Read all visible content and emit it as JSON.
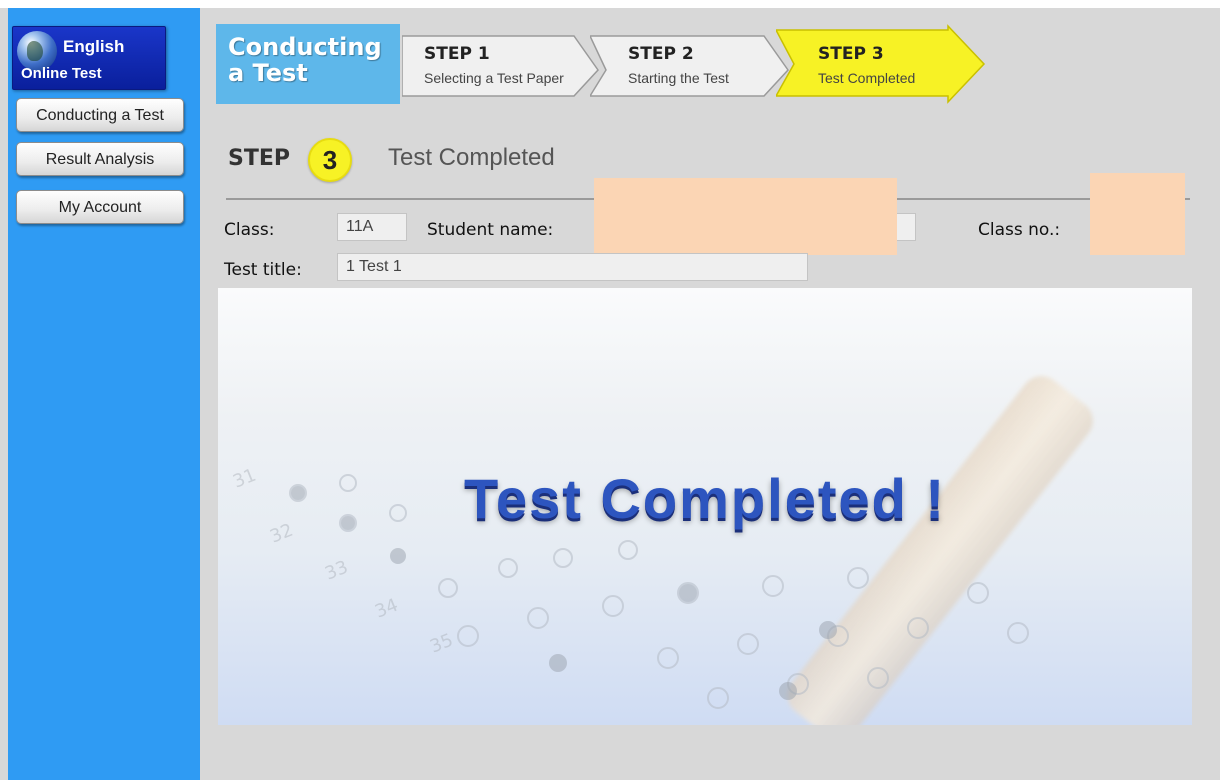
{
  "sidebar": {
    "logo_line1": "English",
    "logo_line2": "Online Test",
    "items": [
      {
        "label": "Conducting a Test"
      },
      {
        "label": "Result Analysis"
      },
      {
        "label": "My Account"
      }
    ]
  },
  "header": {
    "title_line1": "Conducting",
    "title_line2": "a Test",
    "steps": [
      {
        "name": "STEP 1",
        "desc": "Selecting a Test Paper"
      },
      {
        "name": "STEP 2",
        "desc": "Starting the Test"
      },
      {
        "name": "STEP 3",
        "desc": "Test Completed"
      }
    ]
  },
  "section": {
    "step_word": "STEP",
    "step_number": "3",
    "title": "Test Completed"
  },
  "info": {
    "class_label": "Class:",
    "class_value": "11A",
    "student_label": "Student name:",
    "student_value": "",
    "classno_label": "Class no.:",
    "classno_value": "",
    "title_label": "Test title:",
    "title_value": "1 Test 1"
  },
  "banner": {
    "text": "Test Completed !"
  },
  "colors": {
    "sidebar": "#2f9bf3",
    "active_step": "#f7f225",
    "header_title": "#5eb7ea",
    "banner_text": "#2d55bf"
  }
}
